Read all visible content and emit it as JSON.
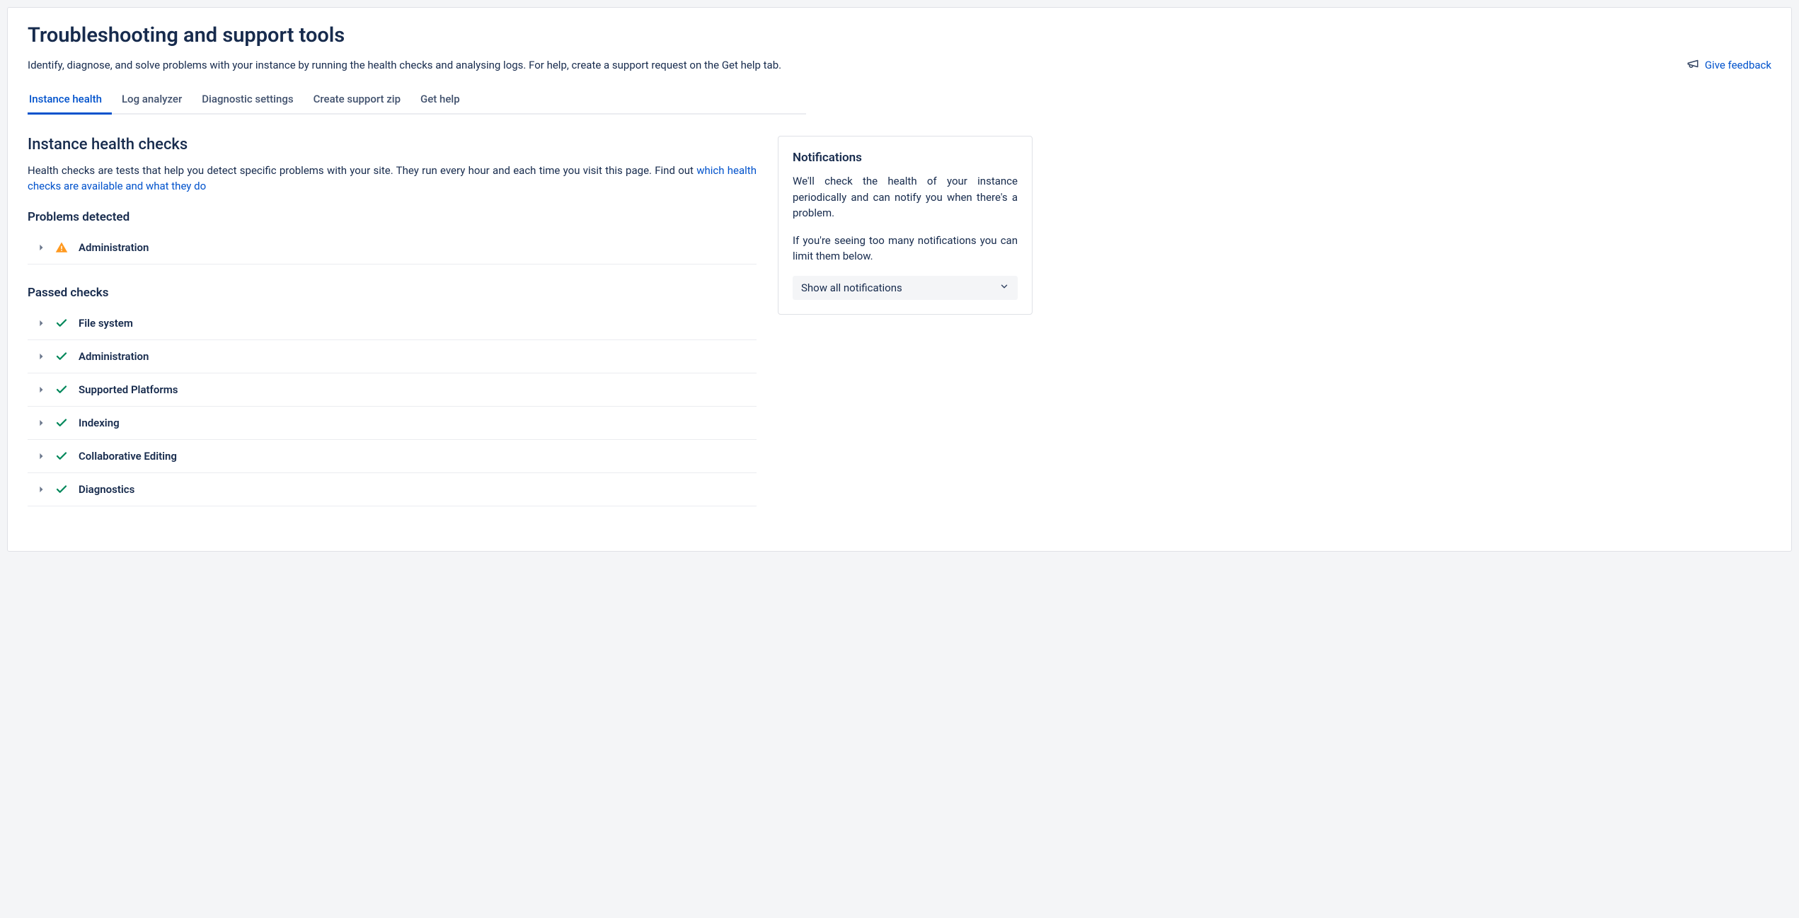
{
  "header": {
    "title": "Troubleshooting and support tools",
    "description": "Identify, diagnose, and solve problems with your instance by running the health checks and analysing logs. For help, create a support request on the Get help tab.",
    "feedback_label": "Give feedback"
  },
  "tabs": [
    {
      "label": "Instance health",
      "active": true
    },
    {
      "label": "Log analyzer",
      "active": false
    },
    {
      "label": "Diagnostic settings",
      "active": false
    },
    {
      "label": "Create support zip",
      "active": false
    },
    {
      "label": "Get help",
      "active": false
    }
  ],
  "main": {
    "section_title": "Instance health checks",
    "section_desc_prefix": "Health checks are tests that help you detect specific problems with your site. They run every hour and each time you visit this page. Find out ",
    "section_desc_link": "which health checks are available and what they do",
    "problems": {
      "heading": "Problems detected",
      "items": [
        {
          "label": "Administration",
          "status": "warning"
        }
      ]
    },
    "passed": {
      "heading": "Passed checks",
      "items": [
        {
          "label": "File system",
          "status": "ok"
        },
        {
          "label": "Administration",
          "status": "ok"
        },
        {
          "label": "Supported Platforms",
          "status": "ok"
        },
        {
          "label": "Indexing",
          "status": "ok"
        },
        {
          "label": "Collaborative Editing",
          "status": "ok"
        },
        {
          "label": "Diagnostics",
          "status": "ok"
        }
      ]
    }
  },
  "notifications": {
    "heading": "Notifications",
    "body1": "We'll check the health of your instance periodically and can notify you when there's a problem.",
    "body2": "If you're seeing too many notifications you can limit them below.",
    "select_value": "Show all notifications"
  }
}
